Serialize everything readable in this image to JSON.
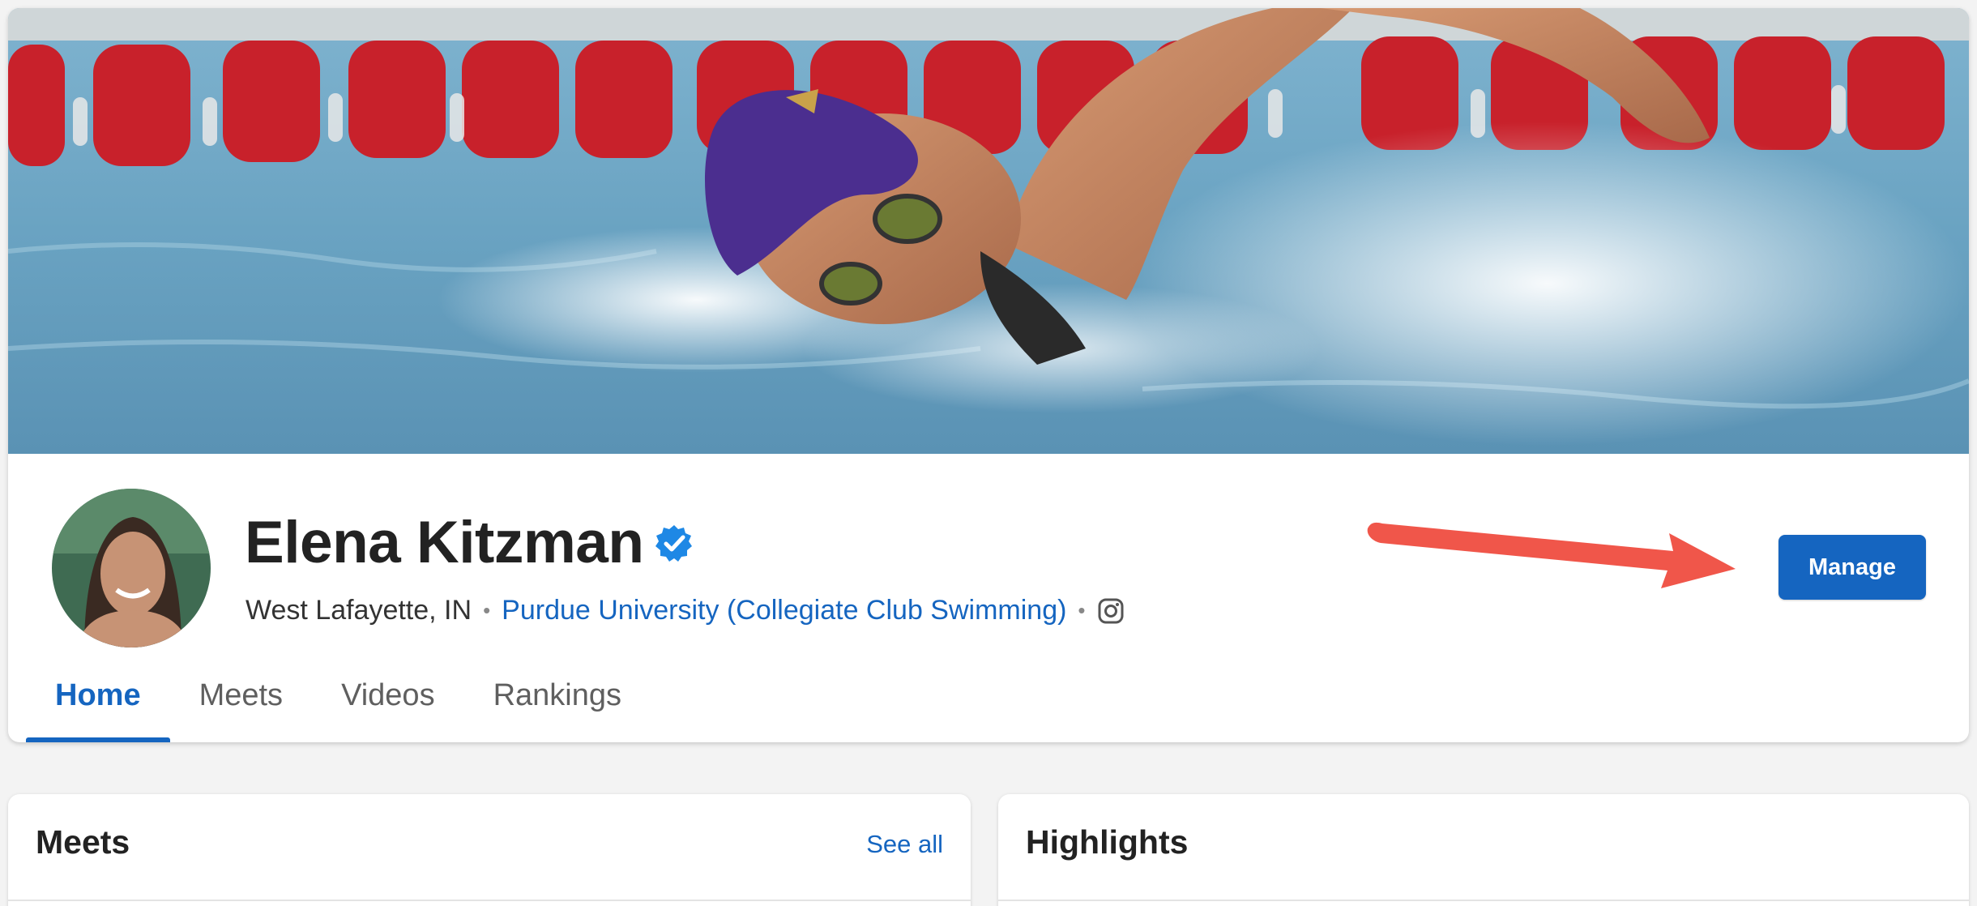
{
  "profile": {
    "name": "Elena Kitzman",
    "location": "West Lafayette, IN",
    "school": "Purdue University (Collegiate Club Swimming)",
    "separator": "•",
    "manage_label": "Manage"
  },
  "tabs": [
    {
      "label": "Home",
      "active": true
    },
    {
      "label": "Meets",
      "active": false
    },
    {
      "label": "Videos",
      "active": false
    },
    {
      "label": "Rankings",
      "active": false
    }
  ],
  "meets": {
    "title": "Meets",
    "see_all_label": "See all"
  },
  "highlights": {
    "title": "Highlights"
  },
  "colors": {
    "accent": "#1565c0",
    "annotation_arrow": "#f0564a",
    "page_background": "#f3f3f3"
  },
  "icons": {
    "verified": "verified-badge-icon",
    "instagram": "instagram-icon"
  }
}
